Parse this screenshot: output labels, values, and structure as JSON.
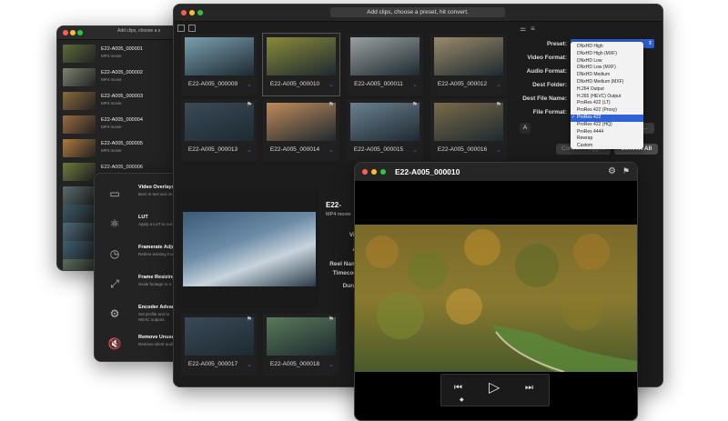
{
  "back_window": {
    "title": "Add clips, choose a s",
    "items": [
      {
        "name": "E22-A005_000001",
        "sub": "MP4 movie",
        "color": "#5c6a3a"
      },
      {
        "name": "E22-A005_000002",
        "sub": "MP4 movie",
        "color": "#7b8470"
      },
      {
        "name": "E22-A005_000003",
        "sub": "MP4 movie",
        "color": "#8a6a3a"
      },
      {
        "name": "E22-A005_000004",
        "sub": "MP4 movie",
        "color": "#9a6a40"
      },
      {
        "name": "E22-A005_000005",
        "sub": "MP4 movie",
        "color": "#b07a3a"
      },
      {
        "name": "E22-A005_000006",
        "sub": "MP4 movie",
        "color": "#6a7a3a"
      }
    ],
    "extra_thumbs": [
      "#586a6a",
      "#3a5a6a",
      "#4a6a7a",
      "#3e5e70",
      "#5a6a5a"
    ]
  },
  "features": [
    {
      "title": "Video Overlays",
      "desc1": "Burn in text and im",
      "desc2": "",
      "icon": "▭"
    },
    {
      "title": "LUT",
      "desc1": "Apply a LUT to out",
      "desc2": "",
      "icon": "⚛"
    },
    {
      "title": "Framerate Adju",
      "desc1": "Retime existing foo",
      "desc2": "",
      "icon": "◷"
    },
    {
      "title": "Frame Resizing",
      "desc1": "Scale footage to a",
      "desc2": "",
      "icon": "⤢"
    },
    {
      "title": "Encoder Advan",
      "desc1": "Set profile and ta",
      "desc2": "HEVC outputs.",
      "icon": "⚙"
    },
    {
      "title": "Remove Unuse",
      "desc1": "Remove silent audi",
      "desc2": "",
      "icon": "🔇"
    }
  ],
  "main": {
    "title": "Add clips, choose a preset, hit convert.",
    "tiles": [
      {
        "name": "E22-A005_000009",
        "color": "#7aa0b0",
        "flag": false,
        "selected": false
      },
      {
        "name": "E22-A005_000010",
        "color": "#8a8a3a",
        "flag": false,
        "selected": true
      },
      {
        "name": "E22-A005_000011",
        "color": "#9aa0a0",
        "flag": false,
        "selected": false
      },
      {
        "name": "E22-A005_000012",
        "color": "#9a8a6a",
        "flag": false,
        "selected": false
      },
      {
        "name": "E22-A005_000013",
        "color": "#3a4a58",
        "flag": true,
        "selected": false
      },
      {
        "name": "E22-A005_000014",
        "color": "#c08a5a",
        "flag": true,
        "selected": false
      },
      {
        "name": "E22-A005_000015",
        "color": "#6a8090",
        "flag": true,
        "selected": false
      },
      {
        "name": "E22-A005_000016",
        "color": "#7a6a4a",
        "flag": true,
        "selected": false
      },
      {
        "name": "E22-A005_000017",
        "color": "#3a4a58",
        "flag": true,
        "selected": false
      },
      {
        "name": "E22-A005_000018",
        "color": "#5a7a5a",
        "flag": true,
        "selected": false
      }
    ],
    "settings": {
      "preset_label": "Preset:",
      "video_format_label": "Video Format:",
      "audio_format_label": "Audio Format:",
      "dest_folder_label": "Dest Folder:",
      "dest_file_name_label": "Dest File Name:",
      "file_format_label": "File Format:",
      "convert_flagged": "Convert Flagged",
      "convert_all": "Convert All",
      "edit_btn": "dit..."
    },
    "preset_options": [
      "DNxHD High",
      "DNxHD High (MXF)",
      "DNxHD Low",
      "DNxHD Low (MXF)",
      "DNxHD Medium",
      "DNxHD Medium (MXF)",
      "H.264 Output",
      "H.265 (HEVC) Output",
      "ProRes 422 (LT)",
      "ProRes 422 (Proxy)",
      "ProRes 422",
      "ProRes 422 (HQ)",
      "ProRes 4444",
      "Rewrap",
      "Custom"
    ],
    "preset_selected": "ProRes 422",
    "info": {
      "name": "E22-",
      "type": "MP4 movie",
      "rows": [
        "Vi",
        "A",
        "Reel Nam",
        "Timecod",
        "Dura"
      ]
    }
  },
  "player": {
    "title": "E22-A005_000010"
  },
  "colors": {
    "accent": "#2d63d6",
    "chevron": "#3f6fd4"
  }
}
